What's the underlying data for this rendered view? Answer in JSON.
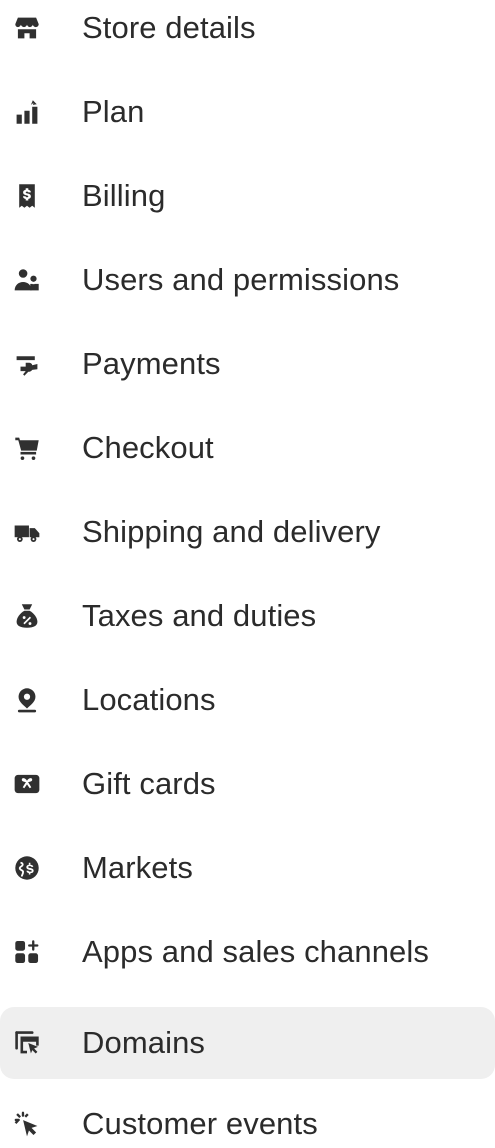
{
  "sidebar": {
    "items": [
      {
        "label": "Store details",
        "icon": "store-icon"
      },
      {
        "label": "Plan",
        "icon": "plan-icon"
      },
      {
        "label": "Billing",
        "icon": "billing-icon"
      },
      {
        "label": "Users and permissions",
        "icon": "users-icon"
      },
      {
        "label": "Payments",
        "icon": "payments-icon"
      },
      {
        "label": "Checkout",
        "icon": "cart-icon"
      },
      {
        "label": "Shipping and delivery",
        "icon": "truck-icon"
      },
      {
        "label": "Taxes and duties",
        "icon": "tax-bag-icon"
      },
      {
        "label": "Locations",
        "icon": "location-pin-icon"
      },
      {
        "label": "Gift cards",
        "icon": "gift-card-icon"
      },
      {
        "label": "Markets",
        "icon": "globe-icon"
      },
      {
        "label": "Apps and sales channels",
        "icon": "apps-icon"
      },
      {
        "label": "Domains",
        "icon": "domains-icon",
        "active": true
      },
      {
        "label": "Customer events",
        "icon": "cursor-click-icon"
      }
    ]
  },
  "colors": {
    "icon": "#303030",
    "text": "#2b2b2b",
    "active_background": "#efefef"
  }
}
